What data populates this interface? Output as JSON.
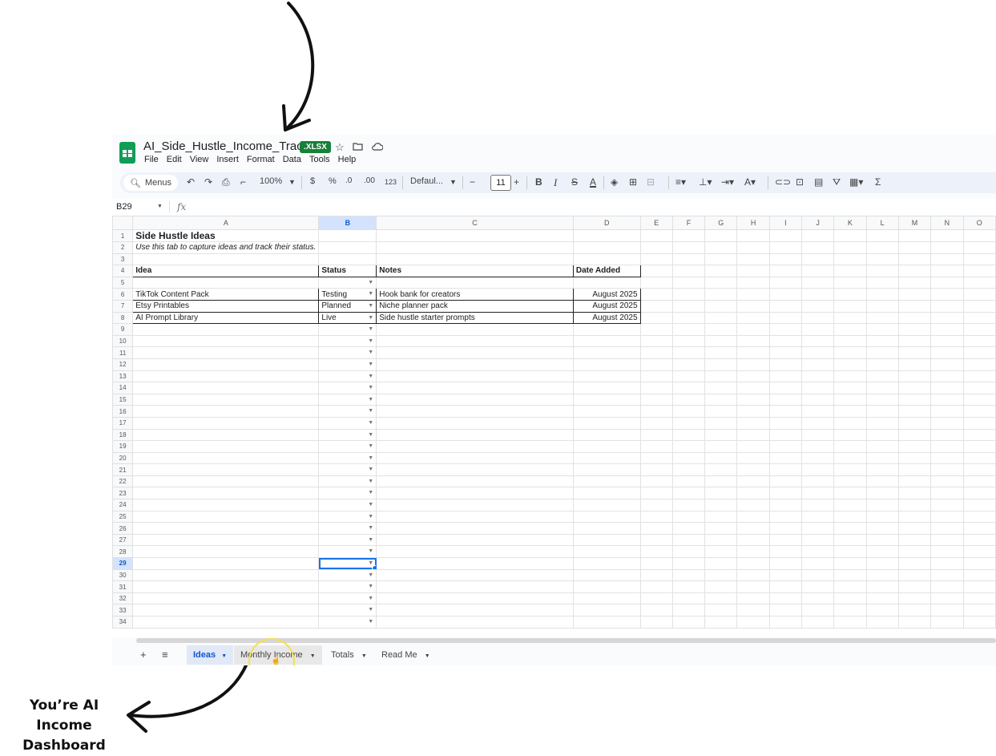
{
  "annotation": {
    "caption_line1": "You’re AI Income",
    "caption_line2": "Dashboard"
  },
  "document": {
    "title": "AI_Side_Hustle_Income_Tracker",
    "badge": ".XLSX"
  },
  "menu": [
    "File",
    "Edit",
    "View",
    "Insert",
    "Format",
    "Data",
    "Tools",
    "Help"
  ],
  "toolbar": {
    "menus_label": "Menus",
    "zoom": "100%",
    "currency": "$",
    "percent": "%",
    "dec_decrease": ".0",
    "dec_increase": ".00",
    "number_format": "123",
    "font": "Defaul...",
    "font_size": "11",
    "bold": "B",
    "italic": "I",
    "strike": "S",
    "text_color": "A",
    "sum": "Σ"
  },
  "formula_bar": {
    "cell_ref": "B29",
    "fx": "fx"
  },
  "columns": [
    "A",
    "B",
    "C",
    "D",
    "E",
    "F",
    "G",
    "H",
    "I",
    "J",
    "K",
    "L",
    "M",
    "N",
    "O"
  ],
  "selected": {
    "column": "B",
    "row": "29"
  },
  "sheet": {
    "title": "Side Hustle Ideas",
    "subtitle": "Use this tab to capture ideas and track their status.",
    "headers": [
      "Idea",
      "Status",
      "Notes",
      "Date Added"
    ],
    "rows": [
      [
        "TikTok Content Pack",
        "Testing",
        "Hook bank for creators",
        "August 2025"
      ],
      [
        "Etsy Printables",
        "Planned",
        "Niche planner pack",
        "August 2025"
      ],
      [
        "AI Prompt Library",
        "Live",
        "Side hustle starter prompts",
        "August 2025"
      ]
    ],
    "row_numbers": [
      "1",
      "2",
      "3",
      "4",
      "5",
      "6",
      "7",
      "8",
      "9",
      "10",
      "11",
      "12",
      "13",
      "14",
      "15",
      "16",
      "17",
      "18",
      "19",
      "20",
      "21",
      "22",
      "23",
      "24",
      "25",
      "26",
      "27",
      "28",
      "29",
      "30",
      "31",
      "32",
      "33",
      "34"
    ]
  },
  "tabs": [
    {
      "label": "Ideas",
      "active": true
    },
    {
      "label": "Monthly Income",
      "active": false
    },
    {
      "label": "Totals",
      "active": false
    },
    {
      "label": "Read Me",
      "active": false
    }
  ],
  "colors": {
    "sheets_green": "#0f9d58",
    "xlsx_badge": "#188038",
    "selection_blue": "#1a73e8"
  }
}
